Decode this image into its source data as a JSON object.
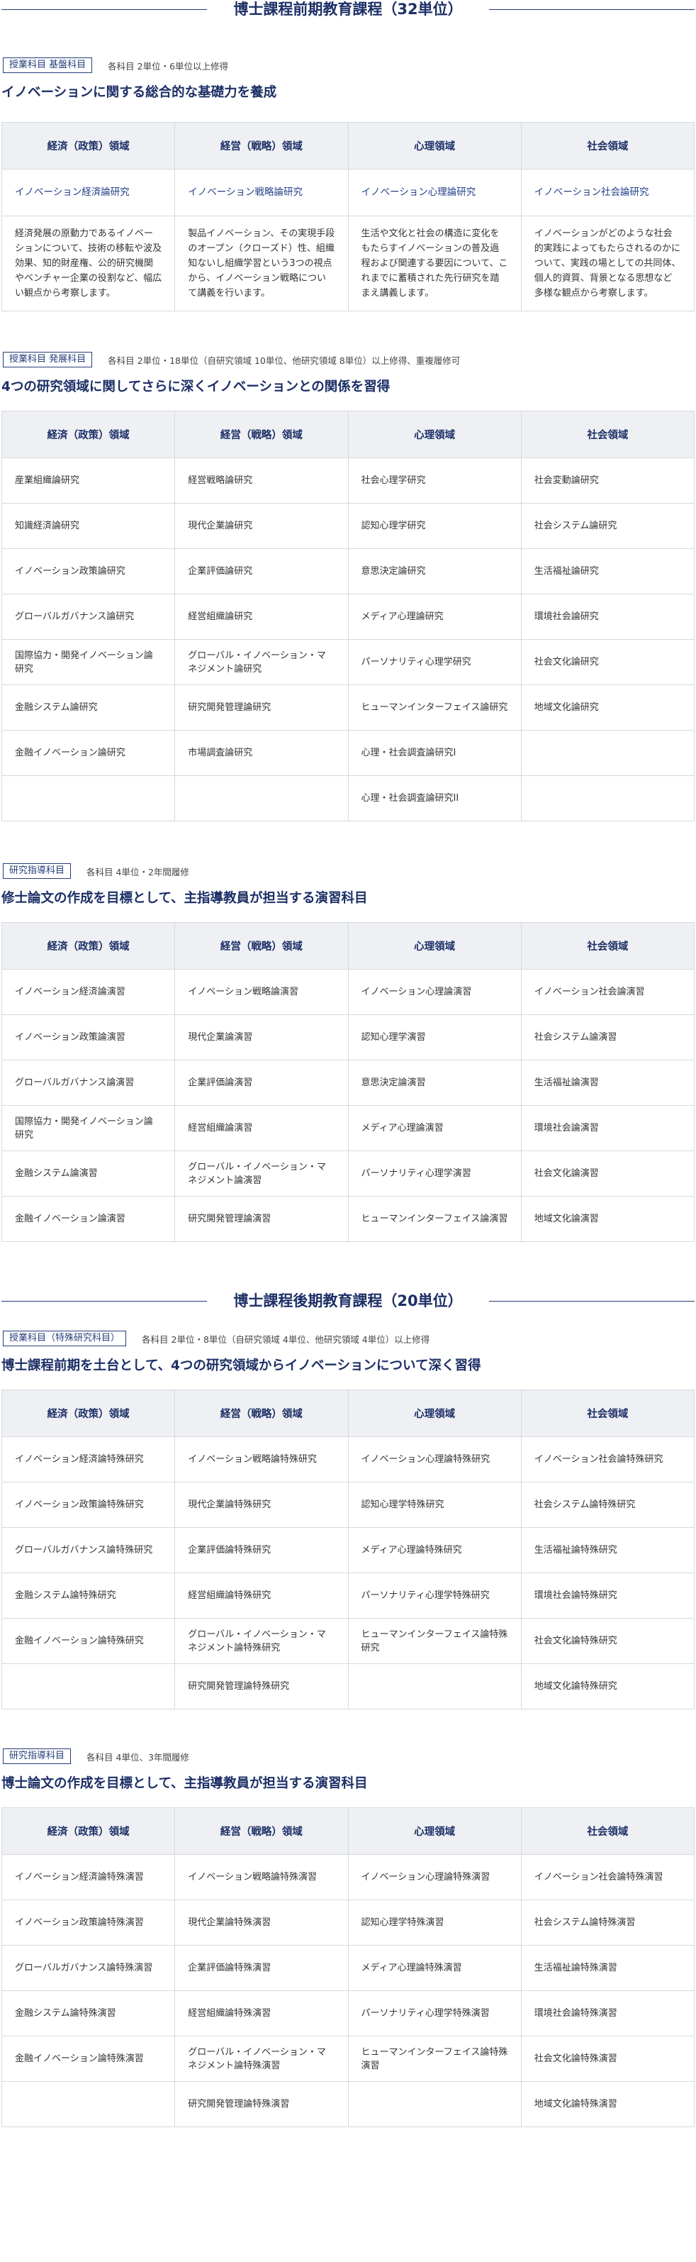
{
  "sections": [
    {
      "title": "博士課程前期教育課程（32単位）",
      "blocks": [
        {
          "tag": "授業科目 基盤科目",
          "note": "各科目 2単位・6単位以上修得",
          "heading": "イノベーションに関する総合的な基礎力を養成",
          "headers": [
            "経済（政策）領域",
            "経営（戦略）領域",
            "心理領域",
            "社会領域"
          ],
          "subjects": [
            "イノベーション経済論研究",
            "イノベーション戦略論研究",
            "イノベーション心理論研究",
            "イノベーション社会論研究"
          ],
          "descriptions": [
            "経済発展の原動力であるイノベーションについて、技術の移転や波及効果、知的財産権、公的研究機関やベンチャー企業の役割など、幅広い観点から考察します。",
            "製品イノベーション、その実現手段のオープン（クローズド）性、組織知ないし組織学習という3つの視点から、イノベーション戦略について講義を行います。",
            "生活や文化と社会の構造に変化をもたらすイノベーションの普及過程および関連する要因について、これまでに蓄積された先行研究を踏まえ講義します。",
            "イノベーションがどのような社会的実践によってもたらされるのかについて、実践の場としての共同体、個人的資質、背景となる思想など多様な観点から考察します。"
          ]
        },
        {
          "tag": "授業科目 発展科目",
          "note": "各科目 2単位・18単位（自研究領域 10単位、他研究領域 8単位）以上修得、重複履修可",
          "heading": "4つの研究領域に関してさらに深くイノベーションとの関係を習得",
          "headers": [
            "経済（政策）領域",
            "経営（戦略）領域",
            "心理領域",
            "社会領域"
          ],
          "rows": [
            [
              "産業組織論研究",
              "経営戦略論研究",
              "社会心理学研究",
              "社会変動論研究"
            ],
            [
              "知識経済論研究",
              "現代企業論研究",
              "認知心理学研究",
              "社会システム論研究"
            ],
            [
              "イノベーション政策論研究",
              "企業評価論研究",
              "意思決定論研究",
              "生活福祉論研究"
            ],
            [
              "グローバルガバナンス論研究",
              "経営組織論研究",
              "メディア心理論研究",
              "環境社会論研究"
            ],
            [
              "国際協力・開発イノベーション論研究",
              "グローバル・イノベーション・マネジメント論研究",
              "パーソナリティ心理学研究",
              "社会文化論研究"
            ],
            [
              "金融システム論研究",
              "研究開発管理論研究",
              "ヒューマンインターフェイス論研究",
              "地域文化論研究"
            ],
            [
              "金融イノベーション論研究",
              "市場調査論研究",
              "心理・社会調査論研究I",
              ""
            ],
            [
              "",
              "",
              "心理・社会調査論研究II",
              ""
            ]
          ]
        },
        {
          "tag": "研究指導科目",
          "note": "各科目 4単位・2年間履修",
          "heading": "修士論文の作成を目標として、主指導教員が担当する演習科目",
          "headers": [
            "経済（政策）領域",
            "経営（戦略）領域",
            "心理領域",
            "社会領域"
          ],
          "rows": [
            [
              "イノベーション経済論演習",
              "イノベーション戦略論演習",
              "イノベーション心理論演習",
              "イノベーション社会論演習"
            ],
            [
              "イノベーション政策論演習",
              "現代企業論演習",
              "認知心理学演習",
              "社会システム論演習"
            ],
            [
              "グローバルガバナンス論演習",
              "企業評価論演習",
              "意思決定論演習",
              "生活福祉論演習"
            ],
            [
              "国際協力・開発イノベーション論研究",
              "経営組織論演習",
              "メディア心理論演習",
              "環境社会論演習"
            ],
            [
              "金融システム論演習",
              "グローバル・イノベーション・マネジメント論演習",
              "パーソナリティ心理学演習",
              "社会文化論演習"
            ],
            [
              "金融イノベーション論演習",
              "研究開発管理論演習",
              "ヒューマンインターフェイス論演習",
              "地域文化論演習"
            ]
          ]
        }
      ]
    },
    {
      "title": "博士課程後期教育課程（20単位）",
      "blocks": [
        {
          "tag": "授業科目（特殊研究科目）",
          "note": "各科目 2単位・8単位（自研究領域 4単位、他研究領域 4単位）以上修得",
          "heading": "博士課程前期を土台として、4つの研究領域からイノベーションについて深く習得",
          "headers": [
            "経済（政策）領域",
            "経営（戦略）領域",
            "心理領域",
            "社会領域"
          ],
          "rows": [
            [
              "イノベーション経済論特殊研究",
              "イノベーション戦略論特殊研究",
              "イノベーション心理論特殊研究",
              "イノベーション社会論特殊研究"
            ],
            [
              "イノベーション政策論特殊研究",
              "現代企業論特殊研究",
              "認知心理学特殊研究",
              "社会システム論特殊研究"
            ],
            [
              "グローバルガバナンス論特殊研究",
              "企業評価論特殊研究",
              "メディア心理論特殊研究",
              "生活福祉論特殊研究"
            ],
            [
              "金融システム論特殊研究",
              "経営組織論特殊研究",
              "パーソナリティ心理学特殊研究",
              "環境社会論特殊研究"
            ],
            [
              "金融イノベーション論特殊研究",
              "グローバル・イノベーション・マネジメント論特殊研究",
              "ヒューマンインターフェイス論特殊研究",
              "社会文化論特殊研究"
            ],
            [
              "",
              "研究開発管理論特殊研究",
              "",
              "地域文化論特殊研究"
            ]
          ]
        },
        {
          "tag": "研究指導科目",
          "note": "各科目 4単位、3年間履修",
          "heading": "博士論文の作成を目標として、主指導教員が担当する演習科目",
          "headers": [
            "経済（政策）領域",
            "経営（戦略）領域",
            "心理領域",
            "社会領域"
          ],
          "rows": [
            [
              "イノベーション経済論特殊演習",
              "イノベーション戦略論特殊演習",
              "イノベーション心理論特殊演習",
              "イノベーション社会論特殊演習"
            ],
            [
              "イノベーション政策論特殊演習",
              "現代企業論特殊演習",
              "認知心理学特殊演習",
              "社会システム論特殊演習"
            ],
            [
              "グローバルガバナンス論特殊演習",
              "企業評価論特殊演習",
              "メディア心理論特殊演習",
              "生活福祉論特殊演習"
            ],
            [
              "金融システム論特殊演習",
              "経営組織論特殊演習",
              "パーソナリティ心理学特殊演習",
              "環境社会論特殊演習"
            ],
            [
              "金融イノベーション論特殊演習",
              "グローバル・イノベーション・マネジメント論特殊演習",
              "ヒューマンインターフェイス論特殊演習",
              "社会文化論特殊演習"
            ],
            [
              "",
              "研究開発管理論特殊演習",
              "",
              "地域文化論特殊演習"
            ]
          ]
        }
      ]
    }
  ]
}
